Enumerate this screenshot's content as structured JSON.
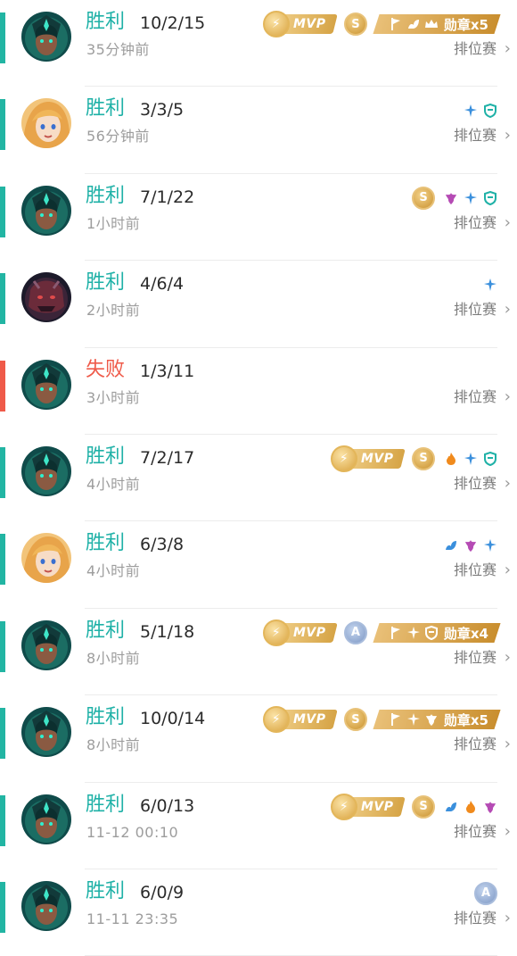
{
  "colors": {
    "win": "#1fb1a7",
    "loss": "#ef5a49",
    "win_bar": "#22b5a3",
    "loss_bar": "#ef5a49"
  },
  "mode_label": "排位赛",
  "chevron": "›",
  "mvp_label": "MVP",
  "matches": [
    {
      "result": "胜利",
      "outcome": "win",
      "kda": "10/2/15",
      "time": "35分钟前",
      "hero": "teal-mage",
      "mvp": true,
      "rank": "S",
      "rank_type": "gold",
      "medal": "勋章x5",
      "medal_icons": [
        "flag-icon",
        "lotus-icon",
        "crown-icon"
      ],
      "icons": []
    },
    {
      "result": "胜利",
      "outcome": "win",
      "kda": "3/3/5",
      "time": "56分钟前",
      "hero": "blonde-girl",
      "mvp": false,
      "rank": "",
      "rank_type": "",
      "medal": "",
      "medal_icons": [],
      "icons": [
        "sword-icon",
        "shield-icon"
      ]
    },
    {
      "result": "胜利",
      "outcome": "win",
      "kda": "7/1/22",
      "time": "1小时前",
      "hero": "teal-mage",
      "mvp": false,
      "rank": "S",
      "rank_type": "gold",
      "medal": "",
      "medal_icons": [],
      "icons": [
        "flower-icon",
        "sword-icon",
        "shield-icon"
      ]
    },
    {
      "result": "胜利",
      "outcome": "win",
      "kda": "4/6/4",
      "time": "2小时前",
      "hero": "dark-beast",
      "mvp": false,
      "rank": "",
      "rank_type": "",
      "medal": "",
      "medal_icons": [],
      "icons": [
        "sword-icon"
      ]
    },
    {
      "result": "失败",
      "outcome": "loss",
      "kda": "1/3/11",
      "time": "3小时前",
      "hero": "teal-mage",
      "mvp": false,
      "rank": "",
      "rank_type": "",
      "medal": "",
      "medal_icons": [],
      "icons": []
    },
    {
      "result": "胜利",
      "outcome": "win",
      "kda": "7/2/17",
      "time": "4小时前",
      "hero": "teal-mage",
      "mvp": true,
      "rank": "S",
      "rank_type": "gold",
      "medal": "",
      "medal_icons": [],
      "icons": [
        "fire-icon",
        "sword-icon",
        "shield-icon"
      ]
    },
    {
      "result": "胜利",
      "outcome": "win",
      "kda": "6/3/8",
      "time": "4小时前",
      "hero": "blonde-girl",
      "mvp": false,
      "rank": "",
      "rank_type": "",
      "medal": "",
      "medal_icons": [],
      "icons": [
        "lotus-icon",
        "flower-icon",
        "sword-icon"
      ]
    },
    {
      "result": "胜利",
      "outcome": "win",
      "kda": "5/1/18",
      "time": "8小时前",
      "hero": "teal-mage",
      "mvp": true,
      "rank": "A",
      "rank_type": "silver",
      "medal": "勋章x4",
      "medal_icons": [
        "flag-icon",
        "sword-icon",
        "shield-icon"
      ],
      "icons": []
    },
    {
      "result": "胜利",
      "outcome": "win",
      "kda": "10/0/14",
      "time": "8小时前",
      "hero": "teal-mage",
      "mvp": true,
      "rank": "S",
      "rank_type": "gold",
      "medal": "勋章x5",
      "medal_icons": [
        "flag-icon",
        "sword-icon",
        "flower-icon"
      ],
      "icons": []
    },
    {
      "result": "胜利",
      "outcome": "win",
      "kda": "6/0/13",
      "time": "11-12 00:10",
      "hero": "teal-mage",
      "mvp": true,
      "rank": "S",
      "rank_type": "gold",
      "medal": "",
      "medal_icons": [],
      "icons": [
        "lotus-icon",
        "fire-icon",
        "flower-icon"
      ]
    },
    {
      "result": "胜利",
      "outcome": "win",
      "kda": "6/0/9",
      "time": "11-11 23:35",
      "hero": "teal-mage",
      "mvp": false,
      "rank": "A",
      "rank_type": "silver",
      "medal": "",
      "medal_icons": [],
      "icons": []
    }
  ]
}
